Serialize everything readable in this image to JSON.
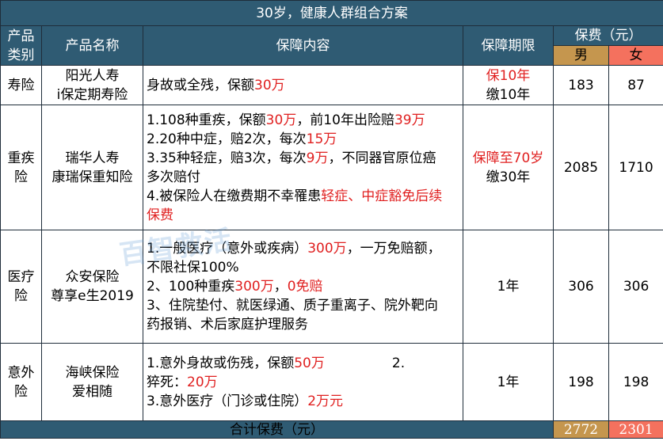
{
  "title": "30岁，健康人群组合方案",
  "headers": {
    "category_line1": "产品",
    "category_line2": "类别",
    "product_name": "产品名称",
    "coverage": "保障内容",
    "period": "保障期限",
    "premium": "保费（元）",
    "male": "男",
    "female": "女"
  },
  "rows": [
    {
      "category": [
        "寿险"
      ],
      "product": [
        "阳光人寿",
        "i保定期寿险"
      ],
      "coverage": [
        [
          {
            "t": "身故或全残，保额"
          },
          {
            "t": "30万",
            "red": true
          }
        ]
      ],
      "period": [
        [
          {
            "t": "保10年",
            "red": true
          }
        ],
        [
          {
            "t": "缴10年"
          }
        ]
      ],
      "male": "183",
      "female": "87"
    },
    {
      "category": [
        "重疾",
        "险"
      ],
      "product": [
        "瑞华人寿",
        "康瑞保重知险"
      ],
      "coverage": [
        [
          {
            "t": "1.108种重疾，保额"
          },
          {
            "t": "30万",
            "red": true
          },
          {
            "t": "，前10年出险赔"
          },
          {
            "t": "39万",
            "red": true
          }
        ],
        [
          {
            "t": "2.20种中症，赔2次，每次"
          },
          {
            "t": "15万",
            "red": true
          }
        ],
        [
          {
            "t": "3.35种轻症，赔3次，每次"
          },
          {
            "t": "9万",
            "red": true
          },
          {
            "t": "，不同器官原位癌"
          }
        ],
        [
          {
            "t": "多次赔付"
          }
        ],
        [
          {
            "t": "4.被保险人在缴费期不幸罹患"
          },
          {
            "t": "轻症、中症豁免后续",
            "red": true
          }
        ],
        [
          {
            "t": "保费",
            "red": true
          }
        ]
      ],
      "period": [
        [
          {
            "t": "保障至70岁",
            "red": true
          }
        ],
        [
          {
            "t": "缴30年"
          }
        ]
      ],
      "male": "2085",
      "female": "1710"
    },
    {
      "category": [
        "医疗",
        "险"
      ],
      "product": [
        "众安保险",
        "尊享e生2019"
      ],
      "coverage": [
        [
          {
            "t": "1.一般医疗（意外或疾病）"
          },
          {
            "t": "300万",
            "red": true
          },
          {
            "t": "，一万免赔额，"
          }
        ],
        [
          {
            "t": "不限社保100%"
          }
        ],
        [
          {
            "t": "2、100种重疾"
          },
          {
            "t": "300万",
            "red": true
          },
          {
            "t": "，"
          },
          {
            "t": "0免赔",
            "red": true
          }
        ],
        [
          {
            "t": "3、住院垫付、就医绿通、质子重离子、院外靶向"
          }
        ],
        [
          {
            "t": "药报销、术后家庭护理服务"
          }
        ]
      ],
      "period": [
        [
          {
            "t": "1年"
          }
        ]
      ],
      "male": "306",
      "female": "306"
    },
    {
      "category": [
        "意外",
        "险"
      ],
      "product": [
        "海峡保险",
        "爱相随"
      ],
      "coverage": [
        [
          {
            "t": "1.意外身故或伤残，保额"
          },
          {
            "t": "50万",
            "red": true
          },
          {
            "t": "　　　　　2."
          }
        ],
        [
          {
            "t": "猝死："
          },
          {
            "t": "20万",
            "red": true
          }
        ],
        [
          {
            "t": "3.意外医疗（门诊或住院）"
          },
          {
            "t": "2万元",
            "red": true
          }
        ]
      ],
      "period": [
        [
          {
            "t": "1年"
          }
        ]
      ],
      "male": "198",
      "female": "198"
    }
  ],
  "total": {
    "label": "合计保费（元）",
    "male": "2772",
    "female": "2301"
  },
  "watermark": "百智救活"
}
